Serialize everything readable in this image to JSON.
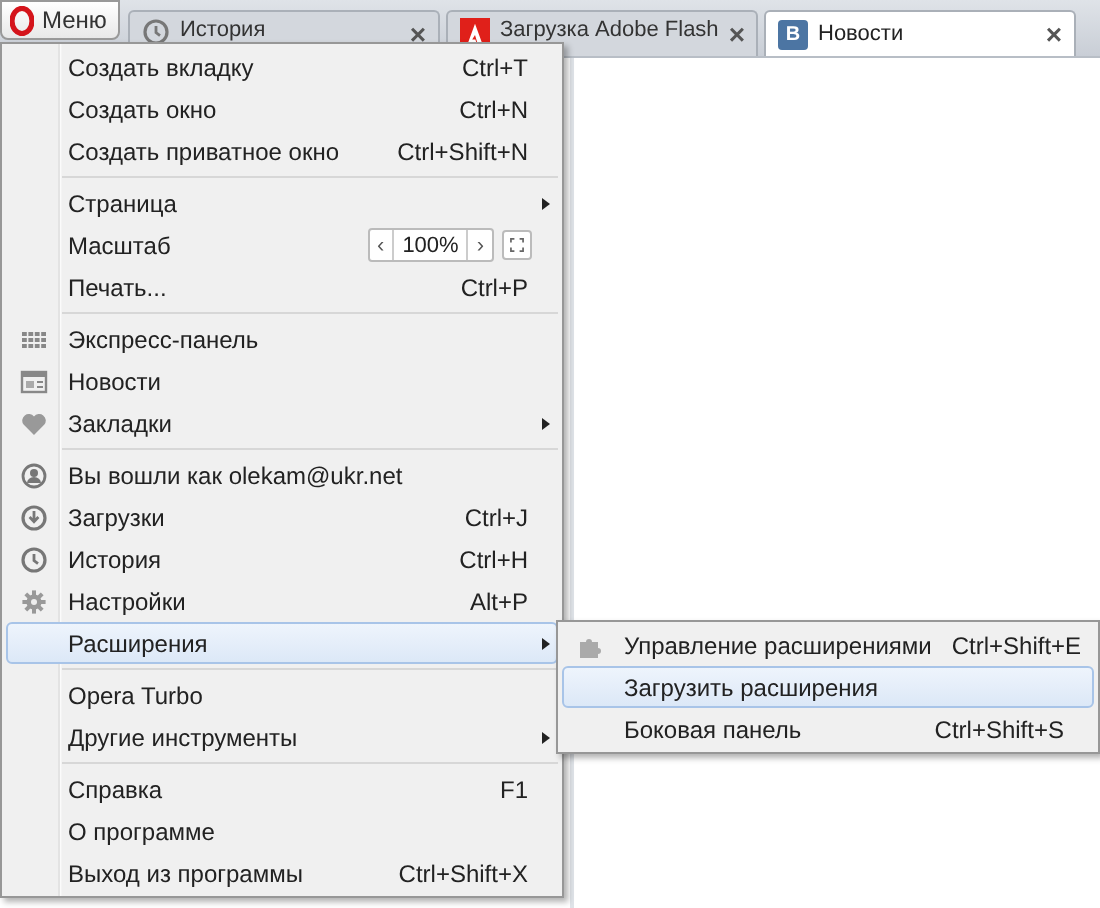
{
  "menu_button": {
    "label": "Меню"
  },
  "tabs": [
    {
      "title": "История",
      "kind": "clock",
      "close": "×",
      "selected": false
    },
    {
      "title": "Загрузка Adobe Flash",
      "kind": "adobe",
      "close": "×",
      "selected": false
    },
    {
      "title": "Новости",
      "kind": "vk",
      "icon_text": "B",
      "close": "×",
      "selected": true
    }
  ],
  "menu": {
    "groups": [
      [
        {
          "kind": "plain",
          "label": "Создать вкладку",
          "shortcut": "Ctrl+T"
        },
        {
          "kind": "plain",
          "label": "Создать окно",
          "shortcut": "Ctrl+N"
        },
        {
          "kind": "plain",
          "label": "Создать приватное окно",
          "shortcut": "Ctrl+Shift+N"
        }
      ],
      [
        {
          "kind": "plain",
          "label": "Страница",
          "submenu": true
        },
        {
          "kind": "zoom",
          "label": "Масштаб",
          "zoom_prev": "‹",
          "zoom_value": "100%",
          "zoom_next": "›"
        },
        {
          "kind": "plain",
          "label": "Печать...",
          "shortcut": "Ctrl+P"
        }
      ],
      [
        {
          "kind": "grid",
          "label": "Экспресс-панель"
        },
        {
          "kind": "news",
          "label": "Новости"
        },
        {
          "kind": "heart",
          "label": "Закладки",
          "submenu": true
        }
      ],
      [
        {
          "kind": "user",
          "label": "Вы вошли как olekam@ukr.net"
        },
        {
          "kind": "download",
          "label": "Загрузки",
          "shortcut": "Ctrl+J"
        },
        {
          "kind": "clock",
          "label": "История",
          "shortcut": "Ctrl+H"
        },
        {
          "kind": "gear",
          "label": "Настройки",
          "shortcut": "Alt+P"
        },
        {
          "kind": "plain",
          "label": "Расширения",
          "submenu": true,
          "selected": true
        }
      ],
      [
        {
          "kind": "plain",
          "label": "Opera Turbo"
        },
        {
          "kind": "plain",
          "label": "Другие инструменты",
          "submenu": true
        }
      ],
      [
        {
          "kind": "plain",
          "label": "Справка",
          "shortcut": "F1"
        },
        {
          "kind": "plain",
          "label": "О программе"
        },
        {
          "kind": "plain",
          "label": "Выход из программы",
          "shortcut": "Ctrl+Shift+X"
        }
      ]
    ]
  },
  "submenu": {
    "items": [
      {
        "kind": "puzzle",
        "label": "Управление расширениями",
        "shortcut": "Ctrl+Shift+E",
        "selected": false
      },
      {
        "kind": "plain",
        "label": "Загрузить расширения",
        "selected": true
      },
      {
        "kind": "plain",
        "label": "Боковая панель",
        "shortcut": "Ctrl+Shift+S",
        "selected": false
      }
    ]
  }
}
